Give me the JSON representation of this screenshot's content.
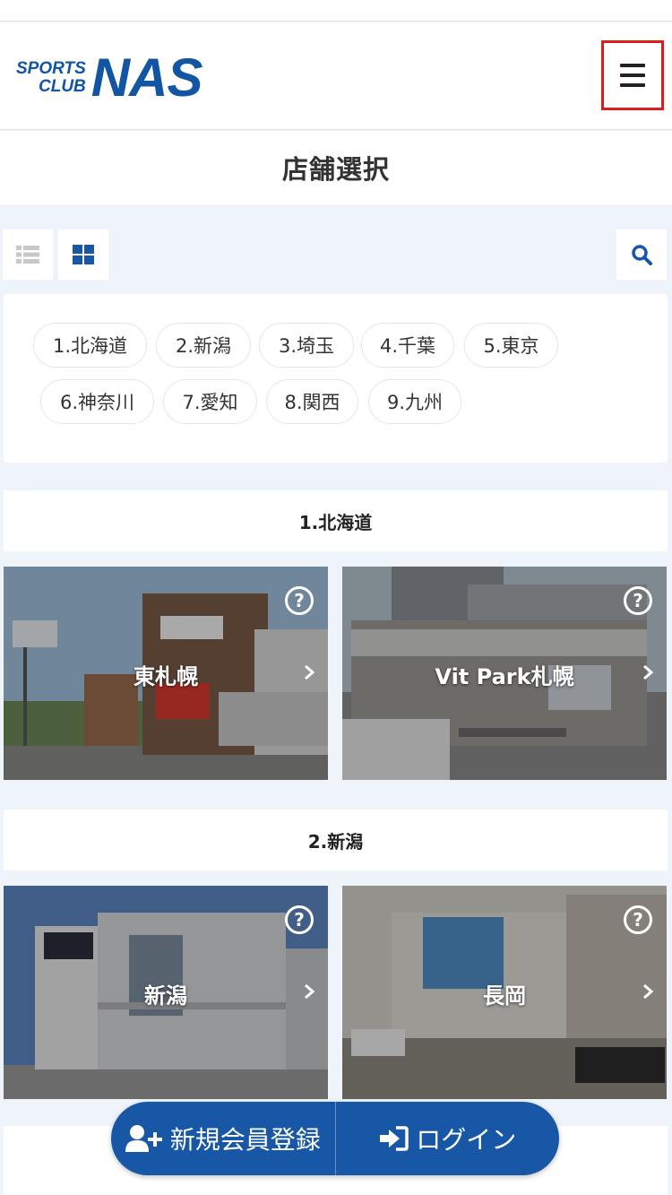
{
  "header": {
    "logo_small_line1": "SPORTS",
    "logo_small_line2": "CLUB",
    "logo_big": "NAS",
    "menu_icon": "hamburger-menu-icon"
  },
  "page": {
    "title": "店舗選択"
  },
  "toolbar": {
    "list_view_icon": "list-view-icon",
    "grid_view_icon": "grid-view-icon",
    "search_icon": "search-icon",
    "grid_view_active": true
  },
  "regions": [
    {
      "label": "1.北海道"
    },
    {
      "label": "2.新潟"
    },
    {
      "label": "3.埼玉"
    },
    {
      "label": "4.千葉"
    },
    {
      "label": "5.東京"
    },
    {
      "label": "6.神奈川"
    },
    {
      "label": "7.愛知"
    },
    {
      "label": "8.関西"
    },
    {
      "label": "9.九州"
    }
  ],
  "sections": [
    {
      "heading": "1.北海道",
      "stores": [
        {
          "name": "東札幌"
        },
        {
          "name": "Vit Park札幌"
        }
      ]
    },
    {
      "heading": "2.新潟",
      "stores": [
        {
          "name": "新潟"
        },
        {
          "name": "長岡"
        }
      ]
    }
  ],
  "card_help_glyph": "?",
  "cta": {
    "register_label": "新規会員登録",
    "login_label": "ログイン",
    "register_icon": "user-plus-icon",
    "login_icon": "sign-in-icon"
  },
  "colors": {
    "brand_blue": "#1155a3",
    "cta_blue": "#1757a6",
    "highlight_red": "#e01b1b",
    "page_bg": "#eef4fa"
  }
}
